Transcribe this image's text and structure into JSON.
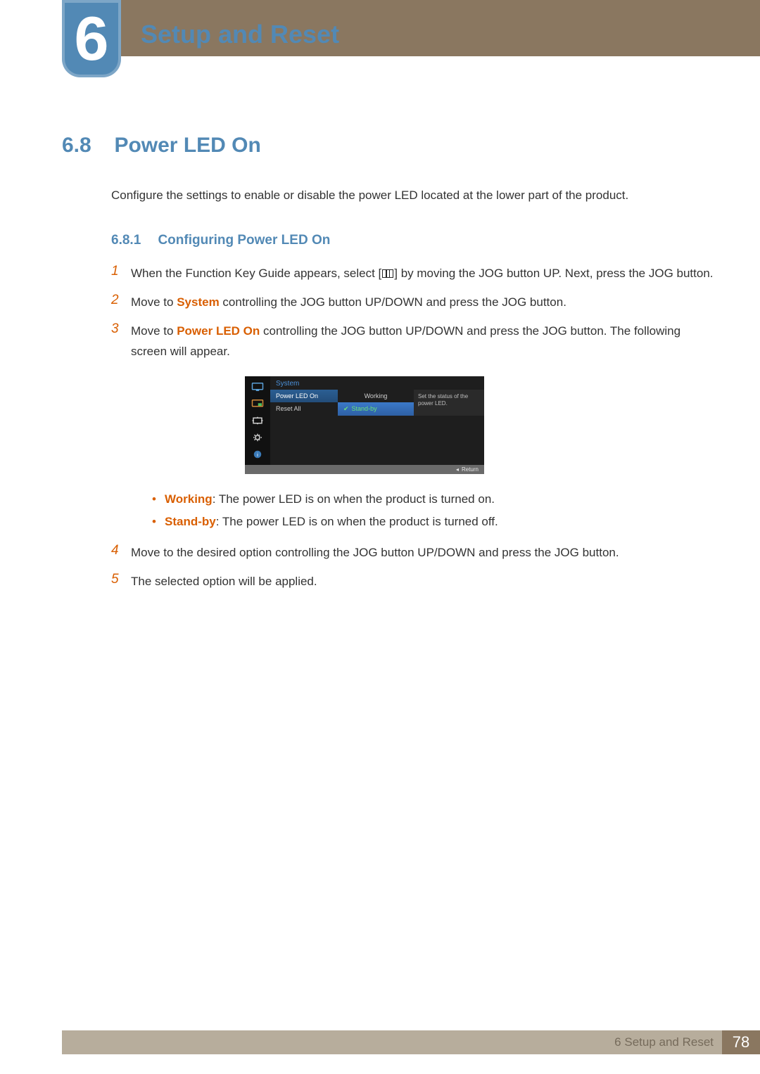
{
  "chapter": {
    "number": "6",
    "title": "Setup and Reset"
  },
  "section": {
    "number": "6.8",
    "title": "Power LED On",
    "intro": "Configure the settings to enable or disable the power LED located at the lower part of the product."
  },
  "subsection": {
    "number": "6.8.1",
    "title": "Configuring Power LED On"
  },
  "steps": {
    "s1n": "1",
    "s1a": "When the Function Key Guide appears, select [",
    "s1b": "] by moving the JOG button UP. Next, press the JOG button.",
    "s2n": "2",
    "s2a": "Move to ",
    "s2kw": "System",
    "s2b": " controlling the JOG button UP/DOWN and press the JOG button.",
    "s3n": "3",
    "s3a": "Move to ",
    "s3kw": "Power LED On",
    "s3b": " controlling the JOG button UP/DOWN and press the JOG button. The following screen will appear.",
    "s4n": "4",
    "s4": "Move to the desired option controlling the JOG button UP/DOWN and press the JOG button.",
    "s5n": "5",
    "s5": "The selected option will be applied."
  },
  "osd": {
    "header": "System",
    "list": [
      "Power LED On",
      "Reset All"
    ],
    "options": [
      "Working",
      "Stand-by"
    ],
    "help": "Set the status of the power LED.",
    "return_arrow": "◂",
    "return": "Return"
  },
  "bullets": {
    "dot": "•",
    "b1kw": "Working",
    "b1": ": The power LED is on when the product is turned on.",
    "b2kw": "Stand-by",
    "b2": ": The power LED is on when the product is turned off."
  },
  "footer": {
    "text": "6 Setup and Reset",
    "page": "78"
  }
}
